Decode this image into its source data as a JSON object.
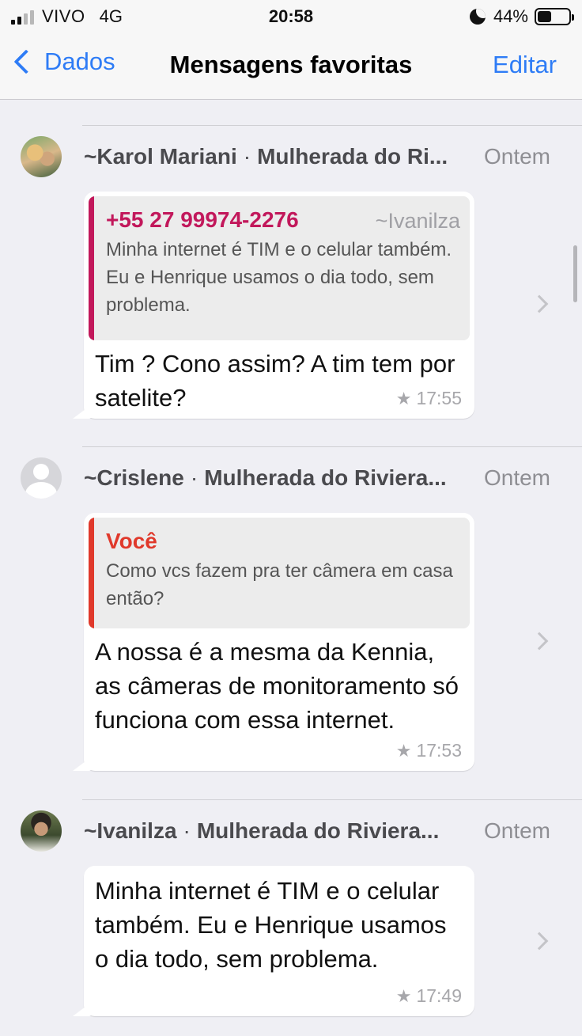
{
  "status_bar": {
    "carrier": "VIVO",
    "network": "4G",
    "time": "20:58",
    "battery": "44%",
    "battery_level": 0.44,
    "do_not_disturb_icon": "moon-icon"
  },
  "nav": {
    "back_label": "Dados",
    "title": "Mensagens favoritas",
    "edit_label": "Editar",
    "back_icon": "chevron-left-icon"
  },
  "messages": [
    {
      "sender": "~Karol Mariani",
      "group": "Mulherada do Ri...",
      "date": "Ontem",
      "quote": {
        "author": "+55 27 99974-2276",
        "author_color": "#c2185b",
        "meta": "~Ivanilza",
        "text": "Minha internet é TIM e o celular também. Eu e Henrique usamos o dia todo, sem problema."
      },
      "text": "Tim ? Cono assim? A tim tem por satelite?",
      "time": "17:55"
    },
    {
      "sender": "~Crislene",
      "group": "Mulherada do Riviera...",
      "date": "Ontem",
      "quote": {
        "author": "Você",
        "author_color": "#e0392b",
        "meta": "",
        "text": "Como vcs fazem pra ter câmera em casa então?"
      },
      "text": "A nossa é a mesma da Kennia, as câmeras de monitoramento só funciona com essa internet.",
      "time": "17:53"
    },
    {
      "sender": "~Ivanilza",
      "group": "Mulherada do Riviera...",
      "date": "Ontem",
      "text": "Minha internet é TIM e o celular também. Eu e Henrique usamos o dia todo, sem problema.",
      "time": "17:49"
    }
  ],
  "colors": {
    "accent": "#2e7cf6",
    "background": "#efeff4"
  }
}
